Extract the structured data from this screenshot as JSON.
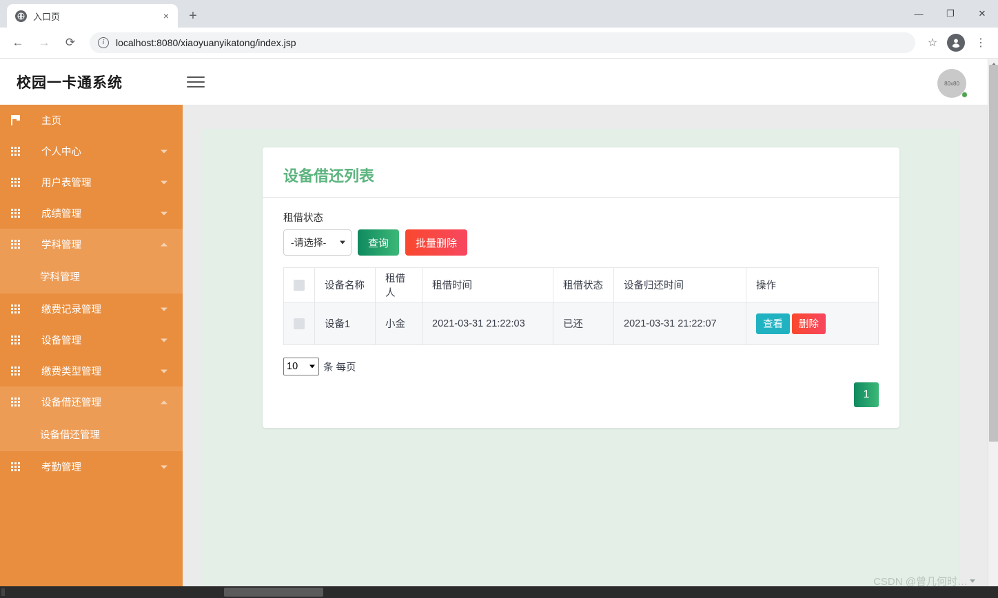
{
  "browser": {
    "tab": {
      "title": "入口页",
      "favicon": "globe-icon",
      "close": "×"
    },
    "newtab_label": "+",
    "window": {
      "minimize": "—",
      "maximize": "❐",
      "close": "✕"
    },
    "nav": {
      "back": "←",
      "forward": "→",
      "reload": "⟳"
    },
    "omnibox": {
      "url": "localhost:8080/xiaoyuanyikatong/index.jsp",
      "info_icon": "i"
    },
    "toolbar": {
      "bookmark": "☆",
      "profile": "person-icon",
      "menu": "⋮"
    }
  },
  "app": {
    "logo": "校园一卡通系统",
    "menu_toggle": "hamburger-icon",
    "avatar_text": "80x80",
    "status": "online"
  },
  "sidebar": {
    "items": [
      {
        "label": "主页",
        "icon": "flag-icon",
        "has_caret": false,
        "state": "none"
      },
      {
        "label": "个人中心",
        "icon": "grid-icon",
        "has_caret": true,
        "state": "collapsed"
      },
      {
        "label": "用户表管理",
        "icon": "grid-icon",
        "has_caret": true,
        "state": "collapsed"
      },
      {
        "label": "成绩管理",
        "icon": "grid-icon",
        "has_caret": true,
        "state": "collapsed"
      },
      {
        "label": "学科管理",
        "icon": "grid-icon",
        "has_caret": true,
        "state": "expanded",
        "children": [
          "学科管理"
        ]
      },
      {
        "label": "缴费记录管理",
        "icon": "grid-icon",
        "has_caret": true,
        "state": "collapsed"
      },
      {
        "label": "设备管理",
        "icon": "grid-icon",
        "has_caret": true,
        "state": "collapsed"
      },
      {
        "label": "缴费类型管理",
        "icon": "grid-icon",
        "has_caret": true,
        "state": "collapsed"
      },
      {
        "label": "设备借还管理",
        "icon": "grid-icon",
        "has_caret": true,
        "state": "expanded",
        "children": [
          "设备借还管理"
        ]
      },
      {
        "label": "考勤管理",
        "icon": "grid-icon",
        "has_caret": true,
        "state": "collapsed"
      }
    ]
  },
  "main": {
    "card_title": "设备借还列表",
    "filter": {
      "label": "租借状态",
      "select_value": "-请选择-",
      "query_button": "查询",
      "batch_delete_button": "批量删除"
    },
    "table": {
      "headers": [
        "",
        "设备名称",
        "租借人",
        "租借时间",
        "租借状态",
        "设备归还时间",
        "操作"
      ],
      "rows": [
        {
          "name": "设备1",
          "person": "小金",
          "borrow_time": "2021-03-31 21:22:03",
          "status": "已还",
          "return_time": "2021-03-31 21:22:07",
          "view_button": "查看",
          "delete_button": "删除"
        }
      ]
    },
    "pagination": {
      "page_size": "10",
      "page_size_suffix": "条 每页",
      "current_page": "1"
    }
  },
  "watermark": {
    "text": "CSDN @曾几何时…"
  },
  "colors": {
    "sidebar": "#e98e3f",
    "sidebar_active": "#ed9c56",
    "title_green": "#5cb47e",
    "content_bg": "#e3efe7",
    "view_teal": "#21b2c2",
    "delete_red": "#f9482e"
  }
}
